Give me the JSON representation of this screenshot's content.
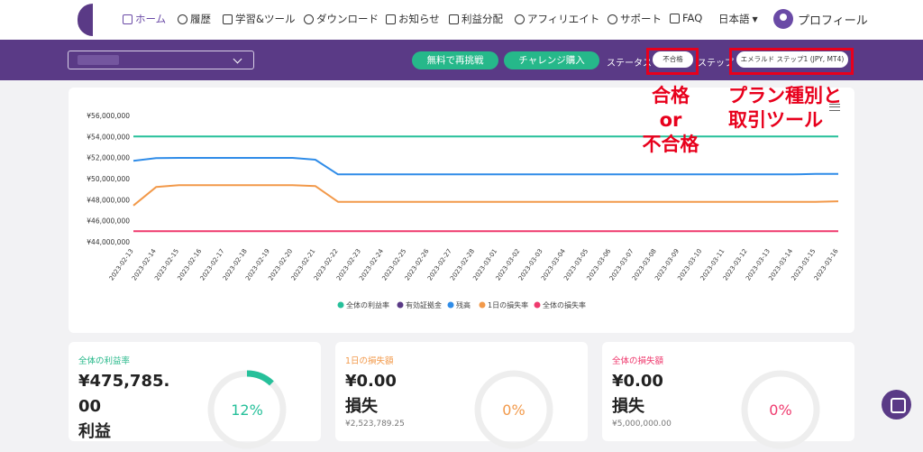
{
  "nav": {
    "home": "ホーム",
    "history": "履歴",
    "learning": "学習&ツール",
    "download": "ダウンロード",
    "news": "お知らせ",
    "profit": "利益分配",
    "affiliate": "アフィリエイト",
    "support": "サポート",
    "faq": "FAQ",
    "language": "日本語",
    "profile": "プロフィール"
  },
  "toolbar": {
    "retry_free": "無料で再挑戦",
    "buy_challenge": "チャレンジ購入",
    "status_label": "ステータス",
    "status_value": "不合格",
    "step_label": "ステップ",
    "step_value": "エメラルド ステップ1 (JPY, MT4)"
  },
  "annotations": {
    "status_line1": "合格",
    "status_line2": "or",
    "status_line3": "不合格",
    "plan_line1": "プラン種別と",
    "plan_line2": "取引ツール"
  },
  "colors": {
    "brand": "#5a3a86",
    "green": "#26b88a",
    "annotation_red": "#e8001c",
    "series_total_profit": "#26c09a",
    "series_margin": "#5a3a86",
    "series_balance": "#2f8ce8",
    "series_daily_loss": "#f2994a",
    "series_total_loss": "#ef3a6e"
  },
  "chart_data": {
    "type": "line",
    "x": [
      "2023-02-13",
      "2023-02-14",
      "2023-02-15",
      "2023-02-16",
      "2023-02-17",
      "2023-02-18",
      "2023-02-19",
      "2023-02-20",
      "2023-02-21",
      "2023-02-22",
      "2023-02-23",
      "2023-02-24",
      "2023-02-25",
      "2023-02-26",
      "2023-02-27",
      "2023-02-28",
      "2023-03-01",
      "2023-03-02",
      "2023-03-03",
      "2023-03-04",
      "2023-03-05",
      "2023-03-06",
      "2023-03-07",
      "2023-03-08",
      "2023-03-09",
      "2023-03-10",
      "2023-03-11",
      "2023-03-12",
      "2023-03-13",
      "2023-03-14",
      "2023-03-15",
      "2023-03-16"
    ],
    "ylim": [
      44000000,
      56000000
    ],
    "yticks": [
      44000000,
      46000000,
      48000000,
      50000000,
      52000000,
      54000000,
      56000000
    ],
    "ytick_labels": [
      "¥44,000,000",
      "¥46,000,000",
      "¥48,000,000",
      "¥50,000,000",
      "¥52,000,000",
      "¥54,000,000",
      "¥56,000,000"
    ],
    "legend_position": "bottom",
    "series": [
      {
        "name": "全体の利益率",
        "color_key": "series_total_profit",
        "values": [
          54000000,
          54000000,
          54000000,
          54000000,
          54000000,
          54000000,
          54000000,
          54000000,
          54000000,
          54000000,
          54000000,
          54000000,
          54000000,
          54000000,
          54000000,
          54000000,
          54000000,
          54000000,
          54000000,
          54000000,
          54000000,
          54000000,
          54000000,
          54000000,
          54000000,
          54000000,
          54000000,
          54000000,
          54000000,
          54000000,
          54000000,
          54000000
        ]
      },
      {
        "name": "有効証拠金",
        "color_key": "series_margin",
        "values": []
      },
      {
        "name": "残高",
        "color_key": "series_balance",
        "values": [
          51700000,
          51950000,
          51970000,
          51970000,
          51970000,
          51970000,
          51970000,
          51970000,
          51800000,
          50400000,
          50400000,
          50400000,
          50400000,
          50400000,
          50400000,
          50400000,
          50400000,
          50400000,
          50400000,
          50400000,
          50400000,
          50400000,
          50400000,
          50400000,
          50400000,
          50400000,
          50400000,
          50400000,
          50400000,
          50400000,
          50450000,
          50450000
        ]
      },
      {
        "name": "1日の損失率",
        "color_key": "series_daily_loss",
        "values": [
          47450000,
          49200000,
          49380000,
          49380000,
          49380000,
          49380000,
          49380000,
          49380000,
          49300000,
          47800000,
          47800000,
          47800000,
          47800000,
          47800000,
          47800000,
          47800000,
          47800000,
          47800000,
          47800000,
          47800000,
          47800000,
          47800000,
          47800000,
          47800000,
          47800000,
          47800000,
          47800000,
          47800000,
          47800000,
          47800000,
          47800000,
          47850000
        ]
      },
      {
        "name": "全体の損失率",
        "color_key": "series_total_loss",
        "values": [
          45000000,
          45000000,
          45000000,
          45000000,
          45000000,
          45000000,
          45000000,
          45000000,
          45000000,
          45000000,
          45000000,
          45000000,
          45000000,
          45000000,
          45000000,
          45000000,
          45000000,
          45000000,
          45000000,
          45000000,
          45000000,
          45000000,
          45000000,
          45000000,
          45000000,
          45000000,
          45000000,
          45000000,
          45000000,
          45000000,
          45000000,
          45000000
        ]
      }
    ]
  },
  "cards": [
    {
      "label": "全体の利益率",
      "value": "¥475,785.\n00\n利益",
      "sub": "",
      "percent": "12%",
      "fraction": 0.12,
      "color_key": "series_total_profit"
    },
    {
      "label": "1日の損失額",
      "value": "¥0.00\n損失",
      "sub": "¥2,523,789.25",
      "percent": "0%",
      "fraction": 0,
      "color_key": "series_daily_loss"
    },
    {
      "label": "全体の損失額",
      "value": "¥0.00\n損失",
      "sub": "¥5,000,000.00",
      "percent": "0%",
      "fraction": 0,
      "color_key": "series_total_loss"
    }
  ]
}
